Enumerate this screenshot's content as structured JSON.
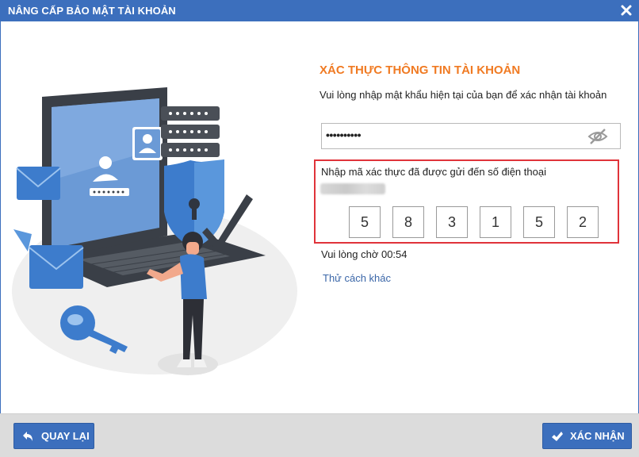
{
  "window": {
    "title": "NÂNG CẤP BẢO MẬT TÀI KHOẢN",
    "close_icon": "close-icon"
  },
  "form": {
    "section_title": "XÁC THỰC THÔNG TIN TÀI KHOẢN",
    "instruction": "Vui lòng nhập mật khẩu hiện tại của bạn để xác nhận tài khoản",
    "password_value": "••••••••••",
    "password_toggle_icon": "eye-slash-icon",
    "otp_label": "Nhập mã xác thực đã được gửi đến số điện thoại",
    "otp_digits": [
      "5",
      "8",
      "3",
      "1",
      "5",
      "2"
    ],
    "countdown": "Vui lòng chờ 00:54",
    "alt_link": "Thử cách khác"
  },
  "footer": {
    "back_label": "QUAY LẠI",
    "back_icon": "undo-arrow-icon",
    "confirm_label": "XÁC NHẬN",
    "confirm_icon": "checkmark-icon"
  },
  "colors": {
    "titlebar": "#3c6fbd",
    "accent_orange": "#f07a22",
    "otp_border": "#e0333a",
    "link": "#3a66a8",
    "footer": "#dcdcdc"
  }
}
